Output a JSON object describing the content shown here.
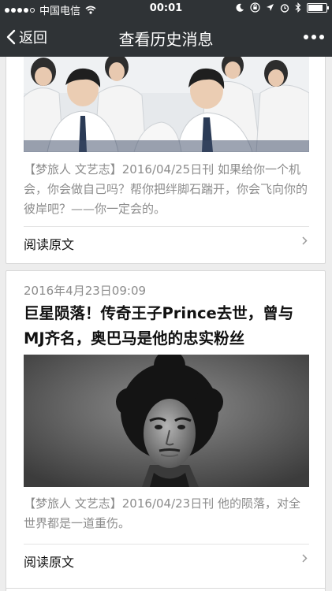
{
  "status_bar": {
    "carrier": "中国电信",
    "time": "00:01",
    "battery_level": 0.9
  },
  "navbar": {
    "back_label": "返回",
    "title": "查看历史消息"
  },
  "articles": [
    {
      "summary": "【梦旅人 文艺志】2016/04/25日刊 如果给你一个机会，你会做自己吗？帮你把绊脚石踹开，你会飞向你的彼岸吧？——你一定会的。",
      "read_more": "阅读原文"
    },
    {
      "date": "2016年4月23日09:09",
      "title": "巨星陨落！传奇王子Prince去世，曾与MJ齐名，奥巴马是他的忠实粉丝",
      "summary": "【梦旅人 文艺志】2016/04/23日刊 他的陨落，对全世界都是一道重伤。",
      "read_more": "阅读原文"
    }
  ],
  "icons": [
    "signal-dots-icon",
    "wifi-icon",
    "moon-icon",
    "lock-rotation-icon",
    "location-icon",
    "alarm-icon",
    "bluetooth-icon",
    "battery-icon",
    "back-chevron-icon",
    "more-dots-icon",
    "chevron-right-icon"
  ],
  "colors": {
    "bar_background": "#2f3336",
    "page_background": "#ededed",
    "meta_text": "#8c8c8c"
  }
}
